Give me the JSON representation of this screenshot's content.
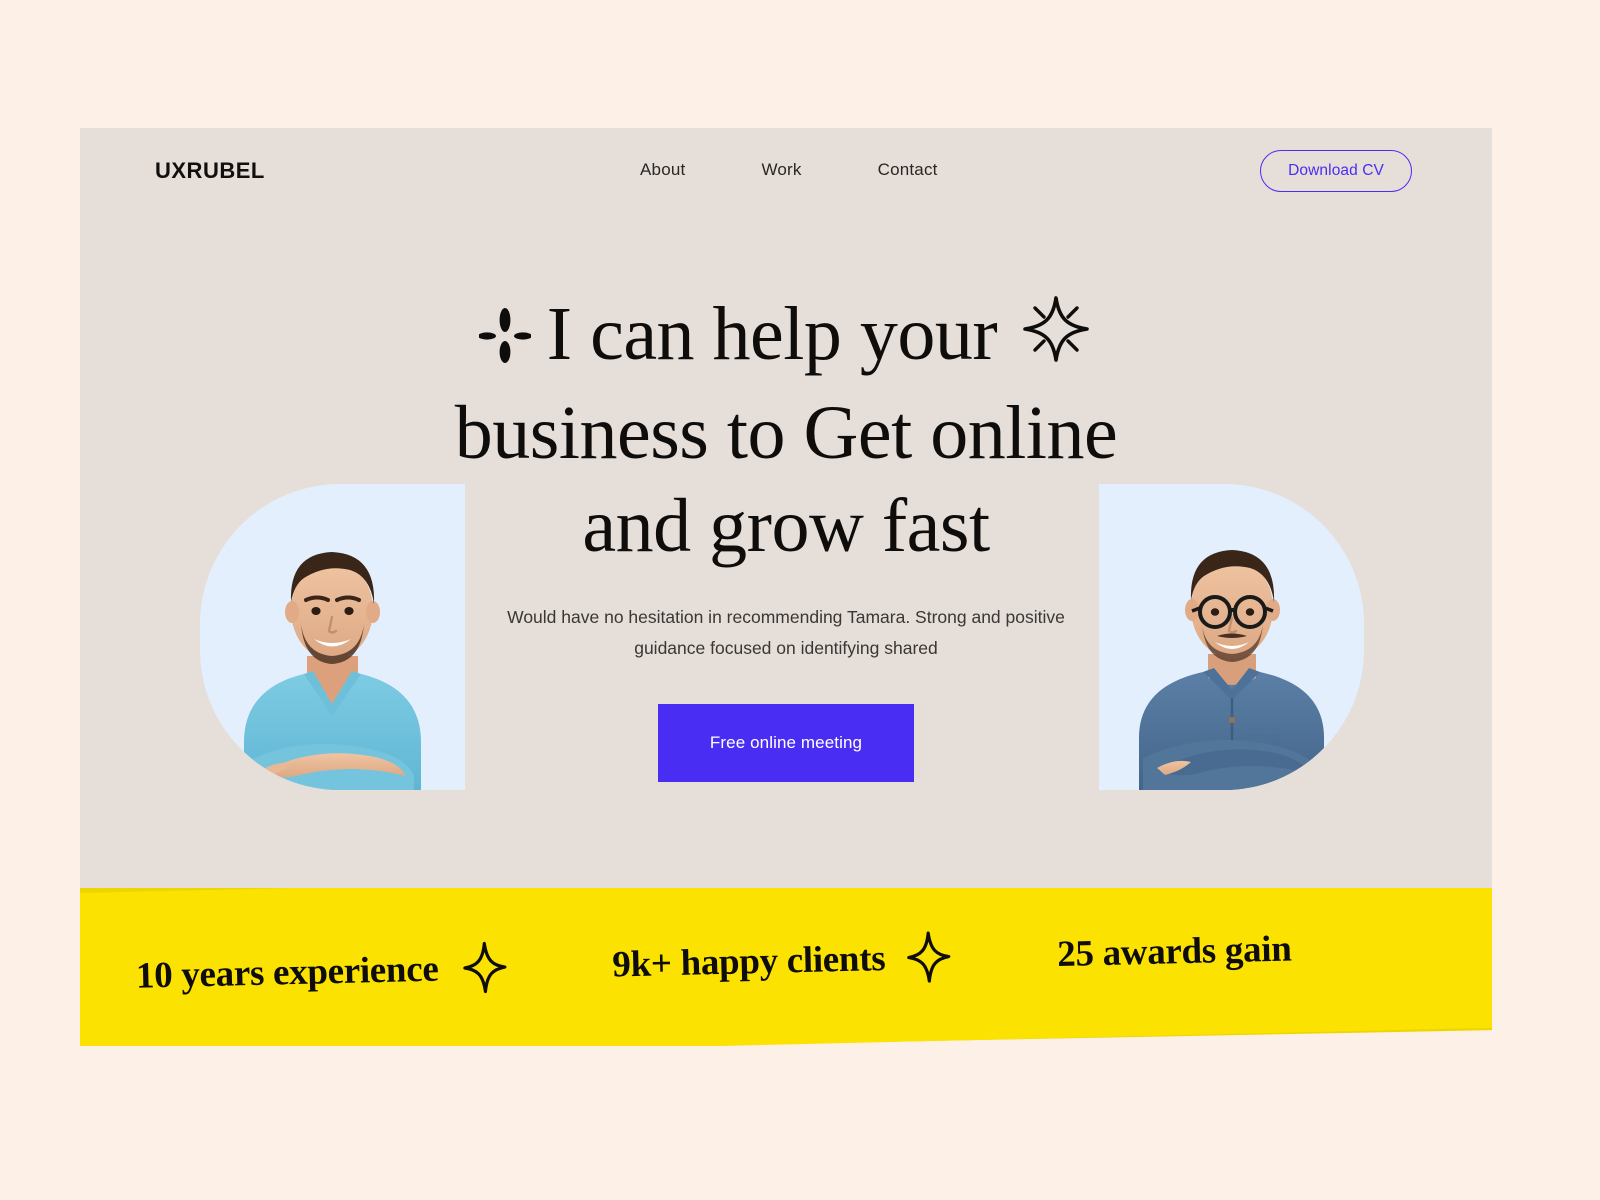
{
  "theme": {
    "page_bg": "#fdf0e7",
    "card_bg": "#e5ded9",
    "accent_purple": "#4a2df3",
    "banner_yellow": "#fbe200",
    "banner_yellow_dark": "#ecd500",
    "photo_bg": "#e3effc",
    "text_dark": "#0f0d0b"
  },
  "nav": {
    "brand": "UXRUBEL",
    "links": [
      {
        "label": "About"
      },
      {
        "label": "Work"
      },
      {
        "label": "Contact"
      }
    ],
    "cta": {
      "label": "Download CV"
    }
  },
  "hero": {
    "headline_lines": [
      "I can help your",
      "business to Get online",
      "and grow fast"
    ],
    "decor_left_icon": "sparkle-four-petal-icon",
    "decor_right_icon": "sparkle-star-burst-icon",
    "subtitle": "Would have no hesitation in recommending Tamara. Strong and positive guidance focused on identifying shared",
    "cta": {
      "label": "Free online meeting"
    },
    "photos": [
      {
        "name": "man-in-teal-tshirt-photo",
        "bg": "#e3effc"
      },
      {
        "name": "man-with-glasses-denim-shirt-photo",
        "bg": "#e3effc"
      }
    ]
  },
  "stats": {
    "items": [
      {
        "label": "10 years experience"
      },
      {
        "label": "9k+ happy clients"
      },
      {
        "label": "25 awards gain"
      }
    ],
    "separator_icon": "four-point-star-icon"
  }
}
